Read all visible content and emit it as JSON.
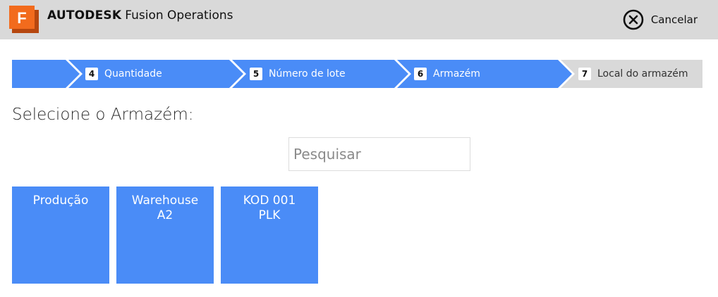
{
  "header": {
    "company": "AUTODESK",
    "product": "Fusion Operations",
    "logo_letter": "F",
    "cancel_label": "Cancelar",
    "cancel_icon": "close-circle-icon"
  },
  "stepper": {
    "steps": [
      {
        "number": "",
        "label": "",
        "state": "completed"
      },
      {
        "number": "4",
        "label": "Quantidade",
        "state": "completed"
      },
      {
        "number": "5",
        "label": "Número de lote",
        "state": "completed"
      },
      {
        "number": "6",
        "label": "Armazém",
        "state": "current"
      },
      {
        "number": "7",
        "label": "Local do armazém",
        "state": "upcoming"
      }
    ]
  },
  "main": {
    "title": "Selecione o Armazém:",
    "search_placeholder": "Pesquisar",
    "warehouses": [
      {
        "line1": "Produção",
        "line2": ""
      },
      {
        "line1": "Warehouse",
        "line2": "A2"
      },
      {
        "line1": "KOD 001",
        "line2": "PLK"
      }
    ]
  },
  "colors": {
    "header_bg": "#d9d9d9",
    "accent_blue": "#4a8cf7",
    "inactive_step": "#d9d9d9",
    "logo_orange": "#f26b1d"
  }
}
